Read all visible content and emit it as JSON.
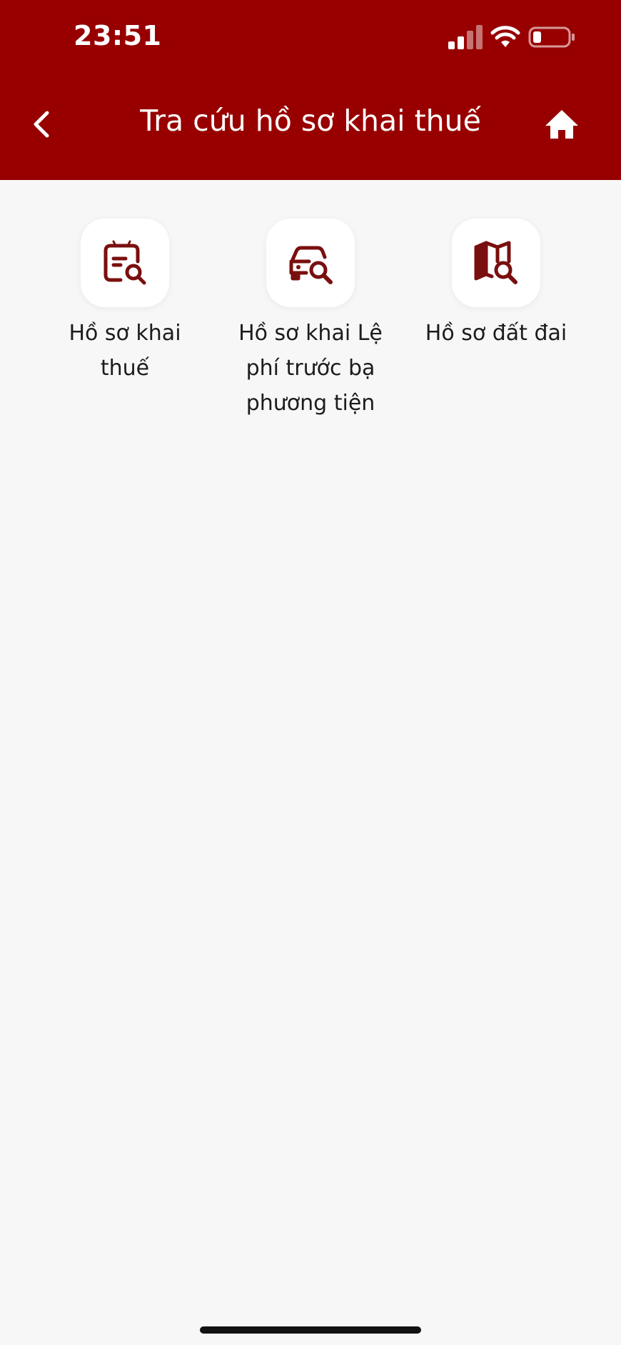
{
  "status_bar": {
    "time": "23:51"
  },
  "header": {
    "title": "Tra cứu hồ sơ khai thuế",
    "background_color": "#980000"
  },
  "menu": [
    {
      "label": "Hồ sơ khai thuế",
      "icon": "tax-document-search-icon"
    },
    {
      "label": "Hồ sơ khai Lệ phí trước bạ phương tiện",
      "icon": "vehicle-search-icon"
    },
    {
      "label": "Hồ sơ đất đai",
      "icon": "land-map-search-icon"
    }
  ],
  "colors": {
    "accent": "#980000",
    "icon": "#7a0f0f",
    "background": "#f7f7f7"
  }
}
